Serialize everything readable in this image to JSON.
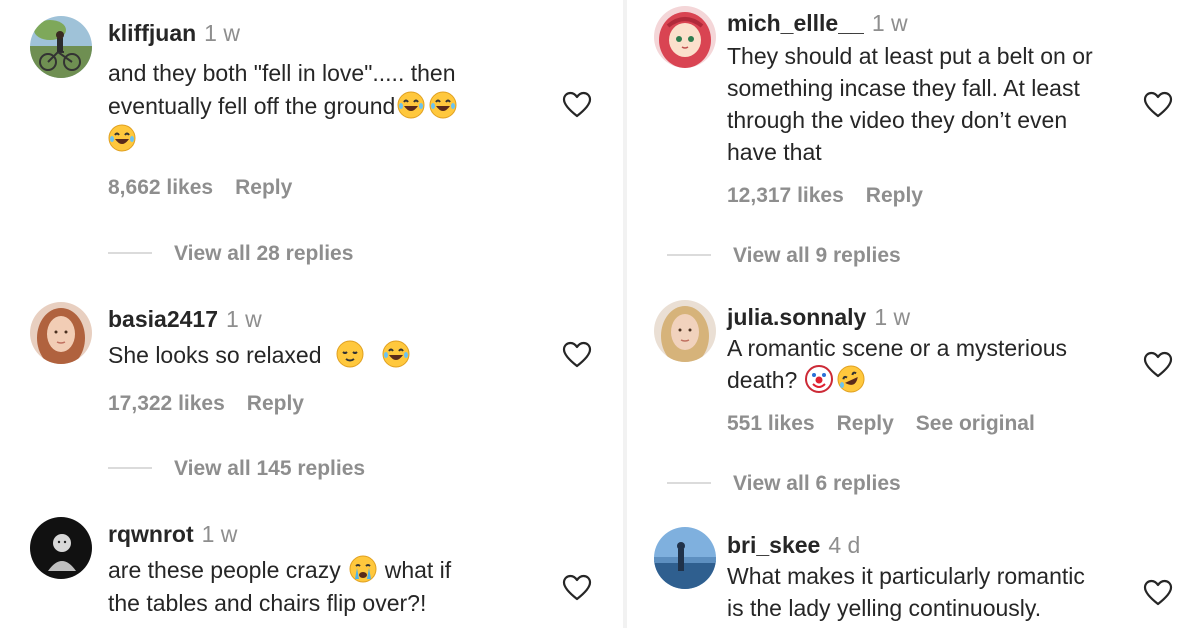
{
  "colors": {
    "text": "#262626",
    "muted": "#8e8e8e",
    "divider": "#dbdbdb"
  },
  "comments_left": [
    {
      "username": "kliffjuan",
      "time": "1 w",
      "text_lines": [
        "and they both \"fell in love\"..... then",
        "eventually fell off the ground"
      ],
      "emojis": [
        "grinning-tears-emoji",
        "grinning-tears-emoji",
        "grinning-tears-emoji"
      ],
      "likes": "8,662 likes",
      "reply": "Reply",
      "view_replies": "View all 28 replies"
    },
    {
      "username": "basia2417",
      "time": "1 w",
      "text": "She looks so relaxed",
      "emojis": [
        "relieved-emoji",
        "grinning-tears-emoji"
      ],
      "likes": "17,322 likes",
      "reply": "Reply",
      "view_replies": "View all 145 replies"
    },
    {
      "username": "rqwnrot",
      "time": "1 w",
      "text_line1_a": "are these people crazy",
      "text_line1_b": "what if",
      "text_line2": "the tables and chairs flip over?!",
      "emojis": [
        "crying-emoji"
      ]
    }
  ],
  "comments_right": [
    {
      "username": "mich_ellle__",
      "time": "1 w",
      "text_lines": [
        "They should at least put a belt on or",
        "something incase they fall. At least",
        "through the video they don’t even",
        "have that"
      ],
      "likes": "12,317 likes",
      "reply": "Reply",
      "view_replies": "View all 9 replies"
    },
    {
      "username": "julia.sonnaly",
      "time": "1 w",
      "text_lines": [
        "A romantic scene or a mysterious",
        "death?"
      ],
      "emojis": [
        "clown-emoji",
        "rofl-emoji"
      ],
      "likes": "551 likes",
      "reply": "Reply",
      "see_original": "See original",
      "view_replies": "View all 6 replies"
    },
    {
      "username": "bri_skee",
      "time": "4 d",
      "text_lines": [
        "What makes it particularly romantic",
        "is the lady yelling continuously."
      ]
    }
  ]
}
